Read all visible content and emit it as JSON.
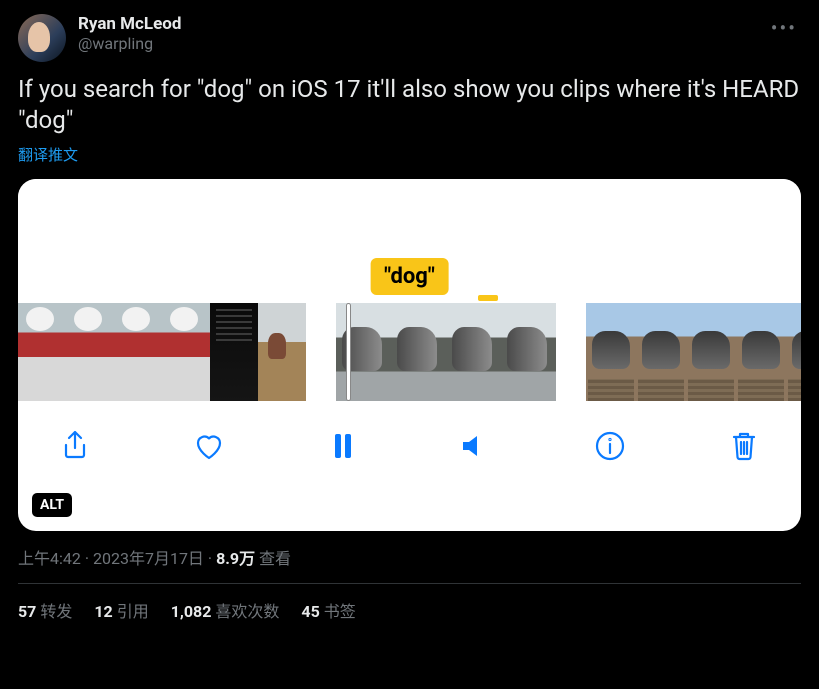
{
  "author": {
    "display_name": "Ryan McLeod",
    "handle": "@warpling"
  },
  "body": "If you search for \"dog\" on iOS 17 it'll also show you clips where it's HEARD \"dog\"",
  "translate_label": "翻译推文",
  "media": {
    "search_token": "\"dog\"",
    "alt_badge": "ALT"
  },
  "meta": {
    "time": "上午4:42",
    "date": "2023年7月17日",
    "views_count": "8.9万",
    "views_label": "查看"
  },
  "stats": {
    "retweets": {
      "count": "57",
      "label": "转发"
    },
    "quotes": {
      "count": "12",
      "label": "引用"
    },
    "likes": {
      "count": "1,082",
      "label": "喜欢次数"
    },
    "bookmarks": {
      "count": "45",
      "label": "书签"
    }
  }
}
